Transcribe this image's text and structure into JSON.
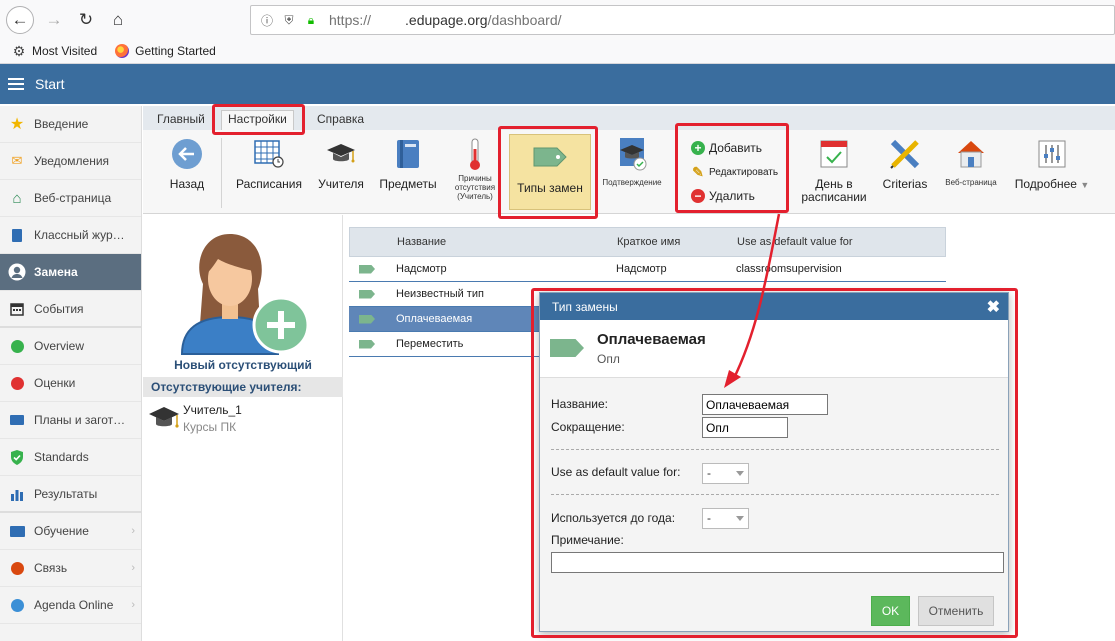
{
  "browser": {
    "url_protocol": "https://",
    "url_host": ".edupage.org",
    "url_path": "/dashboard/",
    "bookmarks": [
      "Most Visited",
      "Getting Started"
    ]
  },
  "app": {
    "title": "Start"
  },
  "sidebar": {
    "items": [
      {
        "label": "Введение",
        "icon": "star-icon"
      },
      {
        "label": "Уведомления",
        "icon": "envelope-icon"
      },
      {
        "label": "Веб-страница",
        "icon": "home-icon"
      },
      {
        "label": "Классный жур…",
        "icon": "journal-icon"
      },
      {
        "label": "Замена",
        "icon": "user-icon",
        "active": true
      },
      {
        "label": "События",
        "icon": "calendar-icon"
      },
      {
        "label": "Overview",
        "icon": "check-circle-icon"
      },
      {
        "label": "Оценки",
        "icon": "grades-icon"
      },
      {
        "label": "Планы и загот…",
        "icon": "briefcase-icon"
      },
      {
        "label": "Standards",
        "icon": "shield-icon"
      },
      {
        "label": "Результаты",
        "icon": "bar-chart-icon"
      },
      {
        "label": "Обучение",
        "icon": "book-icon"
      },
      {
        "label": "Связь",
        "icon": "chat-icon"
      },
      {
        "label": "Agenda Online",
        "icon": "globe-icon"
      }
    ]
  },
  "toolbar": {
    "tabs": [
      "Главный",
      "Настройки",
      "Справка"
    ],
    "buttons": {
      "back": "Назад",
      "schedules": "Расписания",
      "teachers": "Учителя",
      "subjects": "Предметы",
      "reasons_l1": "Причины",
      "reasons_l2": "отсутствия",
      "reasons_l3": "(Учитель)",
      "types": "Типы замен",
      "confirm": "Подтверждение",
      "add": "Добавить",
      "edit": "Редактировать",
      "delete": "Удалить",
      "day_l1": "День в",
      "day_l2": "расписании",
      "criterias": "Criterias",
      "webpage": "Веб-страница",
      "more": "Подробнее"
    }
  },
  "left_panel": {
    "new_absent": "Новый отсутствующий",
    "absent_header": "Отсутствующие учителя:",
    "teacher_name": "Учитель_1",
    "teacher_sub": "Курсы ПК"
  },
  "table": {
    "headers": [
      "Название",
      "Краткое имя",
      "Use as default value for"
    ],
    "rows": [
      {
        "name": "Надсмотр",
        "short": "Надсмотр",
        "default": "classroomsupervision"
      },
      {
        "name": "Неизвестный тип",
        "short": "",
        "default": ""
      },
      {
        "name": "Оплачеваемая",
        "short": "",
        "default": "",
        "selected": true
      },
      {
        "name": "Переместить",
        "short": "",
        "default": ""
      }
    ]
  },
  "dialog": {
    "title": "Тип замены",
    "heading": "Оплачеваемая",
    "subheading": "Опл",
    "name_label": "Название:",
    "name_value": "Оплачеваемая",
    "abbr_label": "Сокращение:",
    "abbr_value": "Опл",
    "default_label": "Use as default value for:",
    "default_value": "-",
    "year_label": "Используется до года:",
    "year_value": "-",
    "note_label": "Примечание:",
    "note_value": "",
    "ok": "OK",
    "cancel": "Отменить"
  },
  "colors": {
    "header_blue": "#3a6d9e",
    "highlight_red": "#e3202e",
    "tag_green": "#7cb58d",
    "ok_green": "#5cb85c",
    "selected_row": "#5f86b8"
  }
}
